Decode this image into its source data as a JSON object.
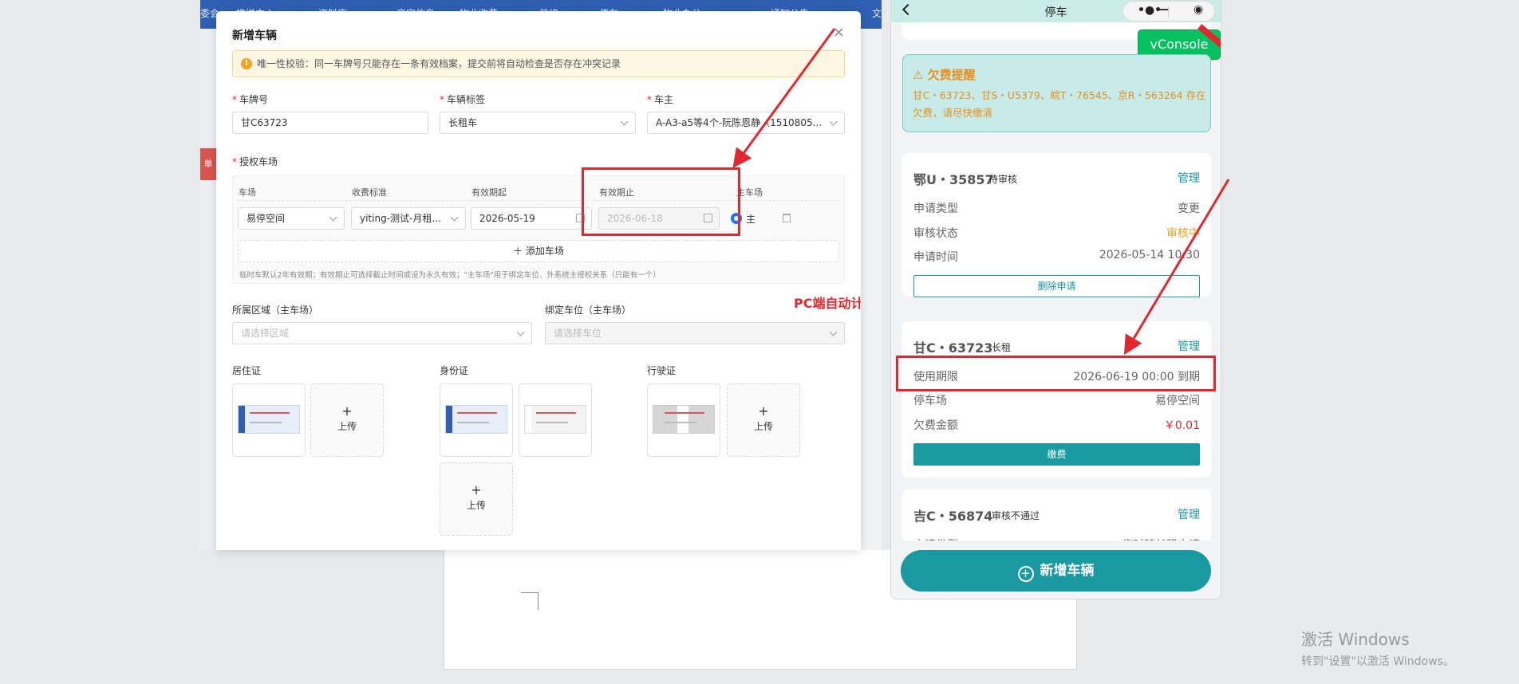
{
  "background": {
    "topbar_items": [
      "委会",
      "推送中心",
      "资料库",
      "商家信息",
      "物业收费",
      "装修",
      "停车",
      "物业办公",
      "通知公告",
      "文"
    ],
    "side_tag": "单"
  },
  "modal": {
    "title": "新增车辆",
    "close_icon": "×",
    "alert_icon": "!",
    "alert_text": "唯一性校验：同一车牌号只能存在一条有效档案，提交前将自动检查是否存在冲突记录",
    "plate": {
      "label": "车牌号",
      "value": "甘C63723"
    },
    "tag": {
      "label": "车辆标签",
      "value": "长租车"
    },
    "owner": {
      "label": "车主",
      "value": "A-A3-a5等4个-阮陈恩静（1510805..."
    },
    "lots": {
      "label": "授权车场",
      "headers": {
        "lot": "车场",
        "fee": "收费标准",
        "start": "有效期起",
        "end": "有效期止",
        "main": "主车场"
      },
      "row": {
        "lot": "易停空间",
        "fee": "yiting-测试-月租...",
        "start": "2026-05-19",
        "end": "2026-06-18",
        "main_label": "主"
      },
      "add_label": "添加车场",
      "hint": "临时车默认2年有效期；有效期止可选择截止时间或设为永久有效；\"主车场\"用于绑定车位、外系统主授权关系（只能有一个）"
    },
    "area": {
      "label": "所属区域（主车场）",
      "placeholder": "请选择区域"
    },
    "space": {
      "label": "绑定车位（主车场）",
      "placeholder": "请选择车位"
    },
    "residence": {
      "label": "居住证"
    },
    "idcard": {
      "label": "身份证"
    },
    "license": {
      "label": "行驶证"
    },
    "upload_label": "上传",
    "annotation": "PC端自动计算的时间和小程序的不一致"
  },
  "phone": {
    "title": "停车",
    "vconsole": "vConsole",
    "warn_title": "⚠ 欠费提醒",
    "warn_text": "甘C・63723、甘S・U5379、皖T・76545、京R・563264 存在欠费，请尽快缴清",
    "cards": [
      {
        "plate": "鄂U・35857",
        "tag": "待审核",
        "manage": "管理",
        "rows": [
          {
            "label": "申请类型",
            "value": "变更"
          },
          {
            "label": "审核状态",
            "value": "审核中"
          },
          {
            "label": "申请时间",
            "value": "2026-05-14 10:30"
          }
        ],
        "button": "删除申请"
      },
      {
        "plate": "甘C・63723",
        "tag": "长租",
        "manage": "管理",
        "rows": [
          {
            "label": "使用期限",
            "value": "2026-06-19 00:00 到期"
          },
          {
            "label": "停车场",
            "value": "易停空间"
          },
          {
            "label": "欠费金额",
            "value": "￥0.01"
          }
        ],
        "button": "缴费"
      },
      {
        "plate": "吉C・56874",
        "tag": "审核不通过",
        "manage": "管理",
        "rows": [
          {
            "label": "申请类型",
            "value": "临时转长租申请"
          }
        ]
      }
    ],
    "add_button": "新增车辆"
  },
  "windows": {
    "line1": "激活 Windows",
    "line2": "转到\"设置\"以激活 Windows。"
  }
}
